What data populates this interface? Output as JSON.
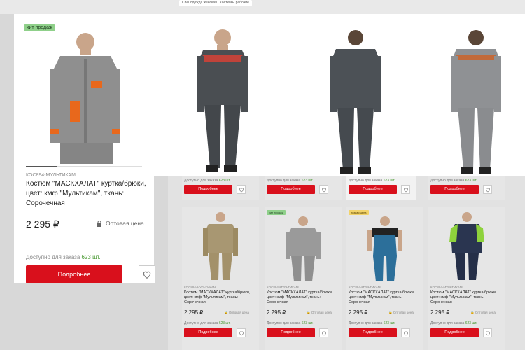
{
  "filters": {
    "chip1": "Спецодежда женская",
    "chip2": "Костюмы рабочие"
  },
  "featured": {
    "badge": "хит продаж",
    "sku": "КОС894-МУЛЬТИКАМ",
    "title": "Костюм \"МАСКХАЛАТ\" куртка/брюки, цвет: кмф \"Мультикам\", ткань: Сорочечная",
    "price": "2 295 ₽",
    "wholesale": "Оптовая цена",
    "availability_label": "Доступно для заказа",
    "availability_count": "623 шт.",
    "button": "Подробнее"
  },
  "row1": [
    {
      "availability_label": "Доступно для заказа",
      "availability_count": "623 шт.",
      "button": "Подробнее"
    },
    {
      "availability_label": "Доступно для заказа",
      "availability_count": "623 шт.",
      "button": "Подробнее"
    },
    {
      "availability_label": "Доступно для заказа",
      "availability_count": "623 шт.",
      "button": "Подробнее"
    },
    {
      "availability_label": "Доступно для заказа",
      "availability_count": "623 шт.",
      "button": "Подробнее"
    }
  ],
  "row2": [
    {
      "badge": "",
      "sku": "КОС894-МУЛЬТИКАМ",
      "title": "Костюм \"МАСКХАЛАТ\" куртка/брюки, цвет: кмф \"Мультикам\", ткань: Сорочечная",
      "price": "2 295 ₽",
      "wholesale": "Оптовая цена",
      "availability_label": "Доступно для заказа",
      "availability_count": "623 шт.",
      "button": "Подробнее"
    },
    {
      "badge": "хит продаж",
      "sku": "КОС894-МУЛЬТИКАМ",
      "title": "Костюм \"МАСКХАЛАТ\" куртка/брюки, цвет: кмф \"Мультикам\", ткань: Сорочечная",
      "price": "2 295 ₽",
      "wholesale": "Оптовая цена",
      "availability_label": "Доступно для заказа",
      "availability_count": "623 шт.",
      "button": "Подробнее"
    },
    {
      "badge": "низкая цена",
      "sku": "КОС894-МУЛЬТИКАМ",
      "title": "Костюм \"МАСКХАЛАТ\" куртка/брюки, цвет: кмф \"Мультикам\", ткань: Сорочечная",
      "price": "2 295 ₽",
      "wholesale": "Оптовая цена",
      "availability_label": "Доступно для заказа",
      "availability_count": "623 шт.",
      "button": "Подробнее"
    },
    {
      "badge": "",
      "sku": "КОС894-МУЛЬТИКАМ",
      "title": "Костюм \"МАСКХАЛАТ\" куртка/брюки, цвет: кмф \"Мультикам\", ткань: Сорочечная",
      "price": "2 295 ₽",
      "wholesale": "Оптовая цена",
      "availability_label": "Доступно для заказа",
      "availability_count": "623 шт.",
      "button": "Подробнее"
    }
  ],
  "colors": {
    "accent": "#d9101c",
    "in_stock": "#4a9a33",
    "badge_hit": "#8fd08a",
    "badge_sale": "#f2d36a"
  }
}
